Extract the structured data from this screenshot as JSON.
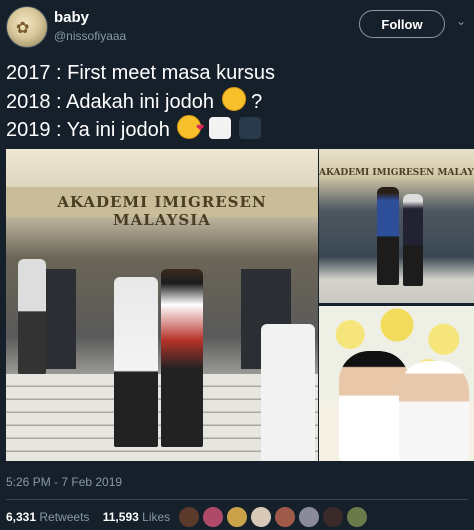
{
  "header": {
    "display_name": "baby",
    "handle": "@nissofiyaaa",
    "follow_label": "Follow",
    "chevron_icon": "chevron-down-icon"
  },
  "tweet": {
    "lines": [
      {
        "text": "2017 : First meet masa kursus",
        "emojis": []
      },
      {
        "text": "2018 : Adakah ini jodoh",
        "emojis": [
          "relieved-face"
        ],
        "suffix": " ?"
      },
      {
        "text": "2019 : Ya ini jodoh",
        "emojis": [
          "smiling-face-with-hearts",
          "bride-with-veil",
          "man-in-tuxedo"
        ]
      }
    ],
    "timestamp": "5:26 PM - 7 Feb 2019"
  },
  "photos": {
    "main_sign": "AKADEMI IMIGRESEN MALAYSIA",
    "small_sign": "AKADEMI IMIGRESEN MALAYSIA"
  },
  "stats": {
    "retweets_count": "6,331",
    "retweets_label": "Retweets",
    "likes_count": "11,593",
    "likes_label": "Likes"
  },
  "colors": {
    "background": "#15202b",
    "secondary_text": "#8899a6",
    "divider": "#38444d"
  }
}
